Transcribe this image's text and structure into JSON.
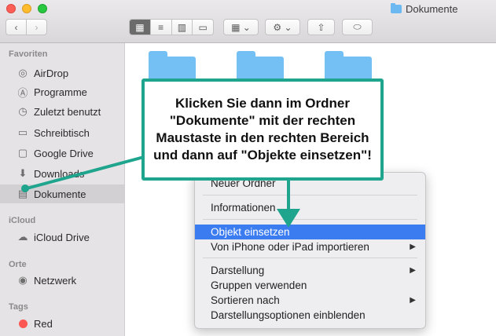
{
  "window": {
    "title": "Dokumente",
    "folder_icon": "folder-icon"
  },
  "toolbar": {
    "back_glyph": "‹",
    "forward_glyph": "›",
    "view_icons": [
      "▦",
      "≡",
      "▥",
      "▭"
    ],
    "group_glyph": "▦ ⌄",
    "action_glyph": "⚙ ⌄",
    "share_glyph": "⇧",
    "tag_glyph": "⬭"
  },
  "sidebar": {
    "favorites_label": "Favoriten",
    "favorites": [
      {
        "label": "AirDrop",
        "icon": "airdrop-icon",
        "glyph": "◎"
      },
      {
        "label": "Programme",
        "icon": "apps-icon",
        "glyph": "Ⓐ"
      },
      {
        "label": "Zuletzt benutzt",
        "icon": "recents-icon",
        "glyph": "◷"
      },
      {
        "label": "Schreibtisch",
        "icon": "desktop-icon",
        "glyph": "▭"
      },
      {
        "label": "Google Drive",
        "icon": "folder-icon",
        "glyph": "▢"
      },
      {
        "label": "Downloads",
        "icon": "download-icon",
        "glyph": "⬇"
      },
      {
        "label": "Dokumente",
        "icon": "document-icon",
        "glyph": "▤",
        "selected": true
      }
    ],
    "icloud_label": "iCloud",
    "icloud_item": {
      "label": "iCloud Drive",
      "icon": "cloud-icon",
      "glyph": "☁"
    },
    "orte_label": "Orte",
    "orte_item": {
      "label": "Netzwerk",
      "icon": "network-icon",
      "glyph": "◉"
    },
    "tags_label": "Tags",
    "tag_item": {
      "label": "Red",
      "color": "#fc5753"
    }
  },
  "context_menu": {
    "items": [
      {
        "label": "Neuer Ordner"
      },
      {
        "label": "Informationen"
      },
      {
        "label": "Objekt einsetzen",
        "highlighted": true
      },
      {
        "label": "Von iPhone oder iPad importieren",
        "submenu": true
      },
      {
        "label": "Darstellung",
        "submenu": true
      },
      {
        "label": "Gruppen verwenden"
      },
      {
        "label": "Sortieren nach",
        "submenu": true
      },
      {
        "label": "Darstellungsoptionen einblenden"
      }
    ],
    "submenu_glyph": "▶"
  },
  "callout": {
    "text": "Klicken Sie dann im Ordner \"Dokumente\" mit der rechten Maustaste in den rechten Bereich und dann auf \"Objekte einsetzen\"!",
    "color": "#1fa58e"
  },
  "colors": {
    "accent": "#3b7cf0",
    "folder": "#74c0f5"
  }
}
